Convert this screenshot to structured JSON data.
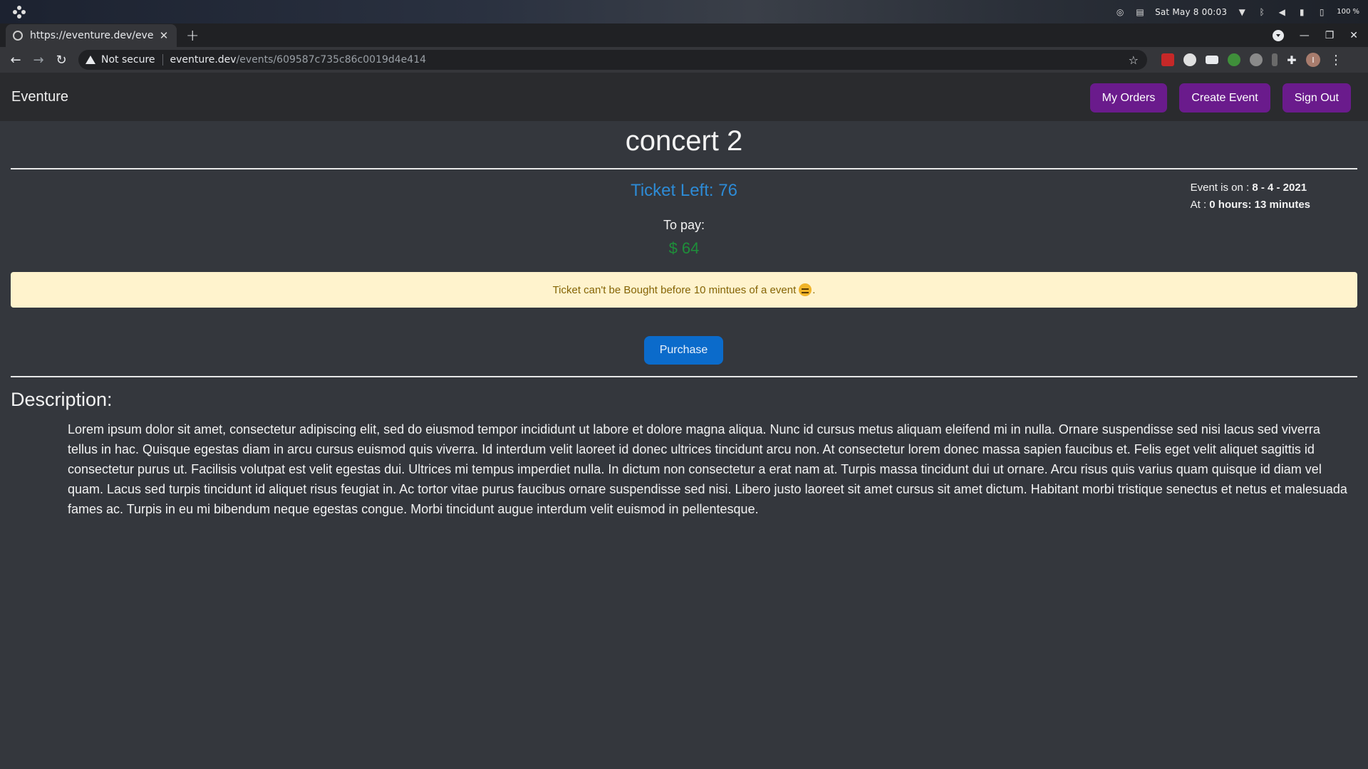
{
  "os_bar": {
    "datetime": "Sat May 8  00:03",
    "battery": "100 %"
  },
  "browser": {
    "tab_title": "https://eventure.dev/eve",
    "new_tab_label": "+",
    "not_secure": "Not secure",
    "url_host": "eventure.dev",
    "url_path": "/events/609587c735c86c0019d4e414",
    "profile_initial": "I"
  },
  "app": {
    "brand": "Eventure",
    "nav": {
      "my_orders": "My Orders",
      "create_event": "Create Event",
      "sign_out": "Sign Out"
    }
  },
  "event": {
    "title": "concert 2",
    "tickets_left": "Ticket Left: 76",
    "to_pay_label": "To pay:",
    "price": "$ 64",
    "date_label": "Event is on : ",
    "date_value": "8 - 4 - 2021",
    "time_label": "At : ",
    "time_value": "0 hours: 13 minutes",
    "alert_text": "Ticket can't be Bought before 10 mintues of a event",
    "alert_suffix": ".",
    "purchase_label": "Purchase",
    "description_heading": "Description:",
    "description": "Lorem ipsum dolor sit amet, consectetur adipiscing elit, sed do eiusmod tempor incididunt ut labore et dolore magna aliqua. Nunc id cursus metus aliquam eleifend mi in nulla. Ornare suspendisse sed nisi lacus sed viverra tellus in hac. Quisque egestas diam in arcu cursus euismod quis viverra. Id interdum velit laoreet id donec ultrices tincidunt arcu non. At consectetur lorem donec massa sapien faucibus et. Felis eget velit aliquet sagittis id consectetur purus ut. Facilisis volutpat est velit egestas dui. Ultrices mi tempus imperdiet nulla. In dictum non consectetur a erat nam at. Turpis massa tincidunt dui ut ornare. Arcu risus quis varius quam quisque id diam vel quam. Lacus sed turpis tincidunt id aliquet risus feugiat in. Ac tortor vitae purus faucibus ornare suspendisse sed nisi. Libero justo laoreet sit amet cursus sit amet dictum. Habitant morbi tristique senectus et netus et malesuada fames ac. Turpis in eu mi bibendum neque egestas congue. Morbi tincidunt augue interdum velit euismod in pellentesque."
  },
  "colors": {
    "nav_button": "#6a1b8c",
    "tickets": "#2d8bd6",
    "price": "#1e8f3a",
    "alert_bg": "#fff3cd",
    "purchase": "#0b6bcb"
  }
}
